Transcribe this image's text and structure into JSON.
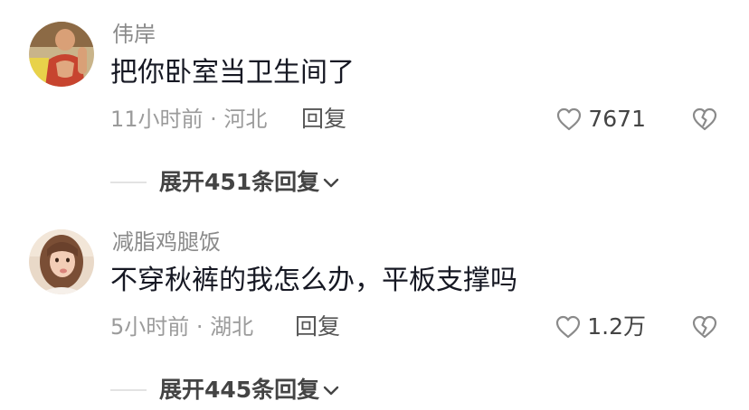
{
  "comments": [
    {
      "username": "伟岸",
      "text": "把你卧室当卫生间了",
      "meta": "11小时前 · 河北",
      "reply_label": "回复",
      "likes": "7671",
      "expand_label": "展开451条回复"
    },
    {
      "username": "减脂鸡腿饭",
      "text": "不穿秋裤的我怎么办，平板支撑吗",
      "meta": "5小时前 · 湖北",
      "reply_label": "回复",
      "likes": "1.2万",
      "expand_label": "展开445条回复"
    }
  ],
  "icons": {
    "like": "heart-outline-icon",
    "dislike": "broken-heart-icon",
    "expand": "chevron-down-icon"
  },
  "colors": {
    "username": "#8a8a8a",
    "content": "#161823",
    "meta": "#9b9b9b",
    "action": "#444444",
    "divider": "#e3e3e3"
  }
}
